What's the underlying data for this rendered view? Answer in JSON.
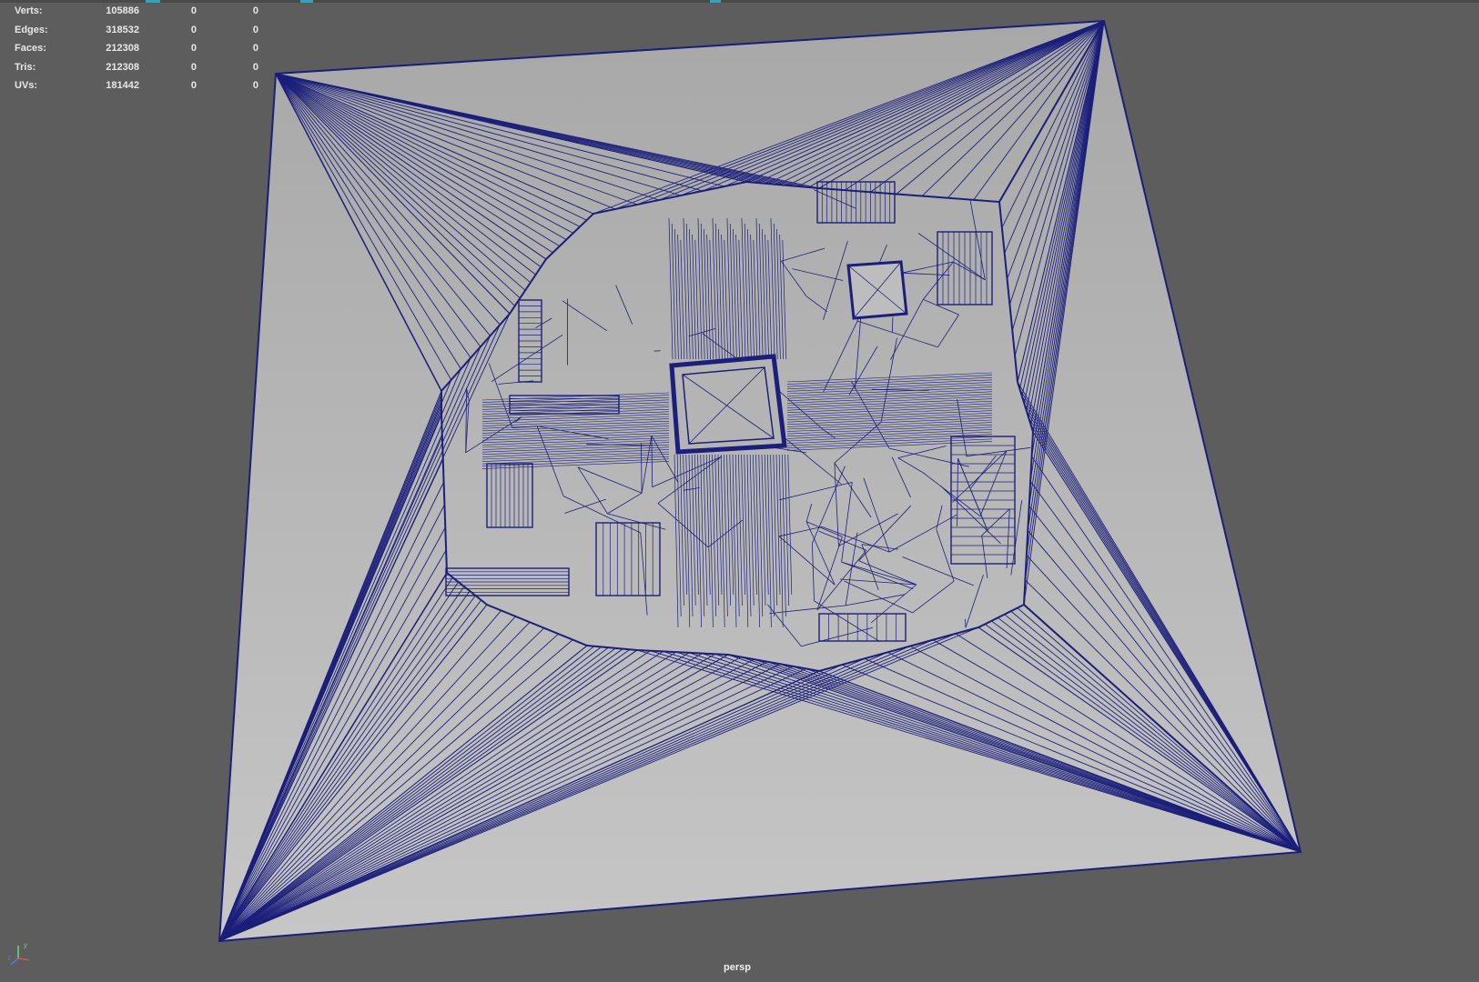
{
  "hud": {
    "rows": [
      {
        "label": "Verts:",
        "v1": "105886",
        "v2": "0",
        "v3": "0"
      },
      {
        "label": "Edges:",
        "v1": "318532",
        "v2": "0",
        "v3": "0"
      },
      {
        "label": "Faces:",
        "v1": "212308",
        "v2": "0",
        "v3": "0"
      },
      {
        "label": "Tris:",
        "v1": "212308",
        "v2": "0",
        "v3": "0"
      },
      {
        "label": "UVs:",
        "v1": "181442",
        "v2": "0",
        "v3": "0"
      }
    ]
  },
  "viewport": {
    "camera": "persp"
  },
  "axis": {
    "x": "x",
    "y": "y",
    "z": "z"
  },
  "colors": {
    "background": "#5d5d5d",
    "wire": "#1b1f7a",
    "surface": "#b9b9b9",
    "accent": "#3aa0b8"
  }
}
